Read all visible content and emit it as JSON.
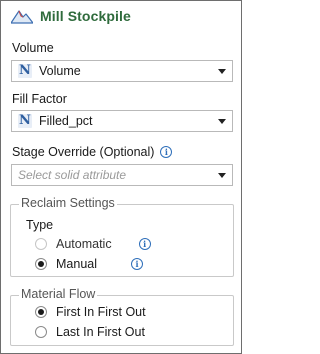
{
  "header": {
    "title": "Mill Stockpile",
    "icon": "mountain-icon"
  },
  "volume": {
    "label": "Volume",
    "value": "Volume",
    "icon": "n-icon"
  },
  "fill_factor": {
    "label": "Fill Factor",
    "value": "Filled_pct",
    "icon": "n-icon"
  },
  "stage_override": {
    "label": "Stage Override (Optional)",
    "placeholder": "Select solid attribute"
  },
  "reclaim_settings": {
    "legend": "Reclaim Settings",
    "type_label": "Type",
    "options": [
      {
        "label": "Automatic",
        "selected": false
      },
      {
        "label": "Manual",
        "selected": true
      }
    ]
  },
  "material_flow": {
    "legend": "Material Flow",
    "options": [
      {
        "label": "First In First Out",
        "selected": true
      },
      {
        "label": "Last In First Out",
        "selected": false
      }
    ]
  },
  "colors": {
    "title_green": "#2f6b3c",
    "info_blue": "#2f6fba",
    "n_icon_blue": "#2f5fa0"
  }
}
